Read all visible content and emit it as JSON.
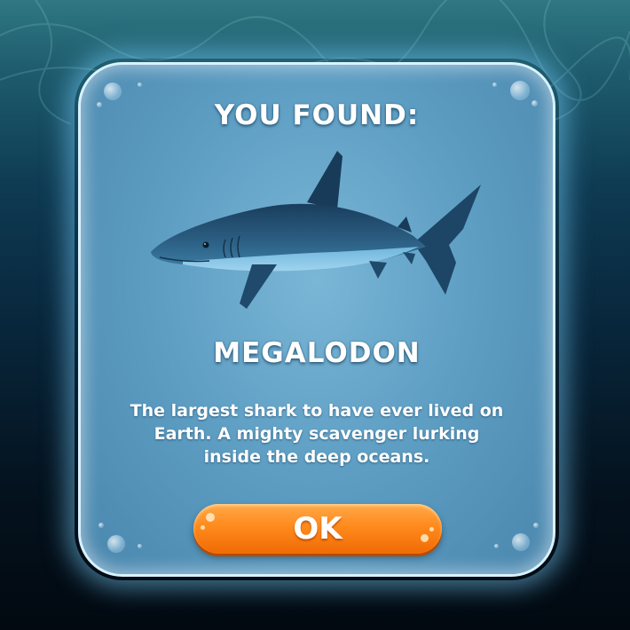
{
  "dialog": {
    "heading": "YOU FOUND:",
    "creature_name": "MEGALODON",
    "description": "The largest shark to have ever lived on Earth. A mighty scavenger lurking inside the deep oceans.",
    "ok_label": "OK"
  },
  "theme": {
    "panel_color": "#5f9fc4",
    "panel_border": "#d8f2ff",
    "button_color": "#ff8a1c",
    "background_top": "#2f7782",
    "background_bottom": "#020910"
  },
  "icons": {
    "creature_image": "shark-illustration"
  }
}
